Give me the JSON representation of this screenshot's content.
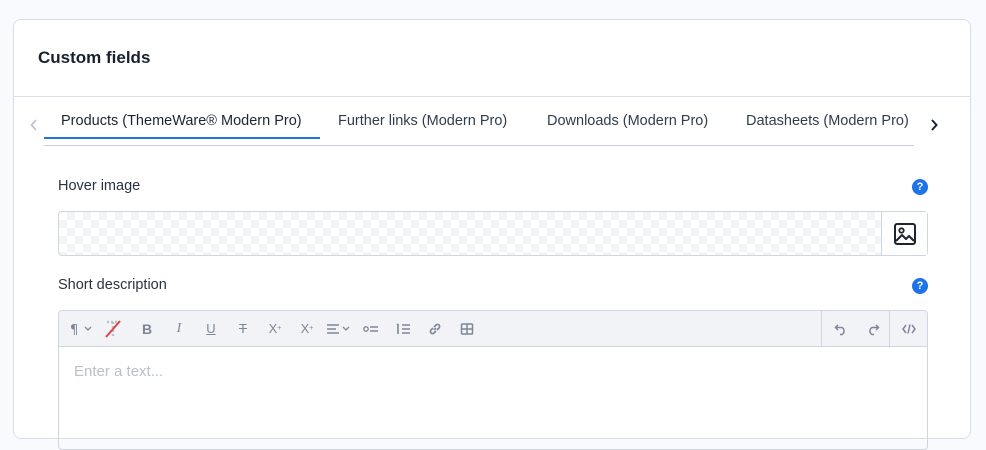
{
  "card": {
    "title": "Custom fields"
  },
  "tabs": [
    {
      "label": "Products (ThemeWare® Modern Pro)",
      "active": true
    },
    {
      "label": "Further links (Modern Pro)",
      "active": false
    },
    {
      "label": "Downloads (Modern Pro)",
      "active": false
    },
    {
      "label": "Datasheets (Modern Pro)",
      "active": false
    }
  ],
  "fields": {
    "hover_image": {
      "label": "Hover image",
      "help": "?"
    },
    "short_description": {
      "label": "Short description",
      "help": "?",
      "placeholder": "Enter a text..."
    }
  },
  "toolbar": {
    "icons": [
      "paragraph-format-icon",
      "remove-format-icon",
      "bold-icon",
      "italic-icon",
      "underline-icon",
      "strikethrough-icon",
      "superscript-icon",
      "subscript-icon",
      "align-icon",
      "unordered-list-icon",
      "ordered-list-icon",
      "link-icon",
      "table-icon",
      "undo-icon",
      "redo-icon",
      "code-view-icon"
    ]
  },
  "colors": {
    "accent": "#1e73e6",
    "border": "#d0d6df",
    "toolbar_bg": "#f1f3f6"
  }
}
